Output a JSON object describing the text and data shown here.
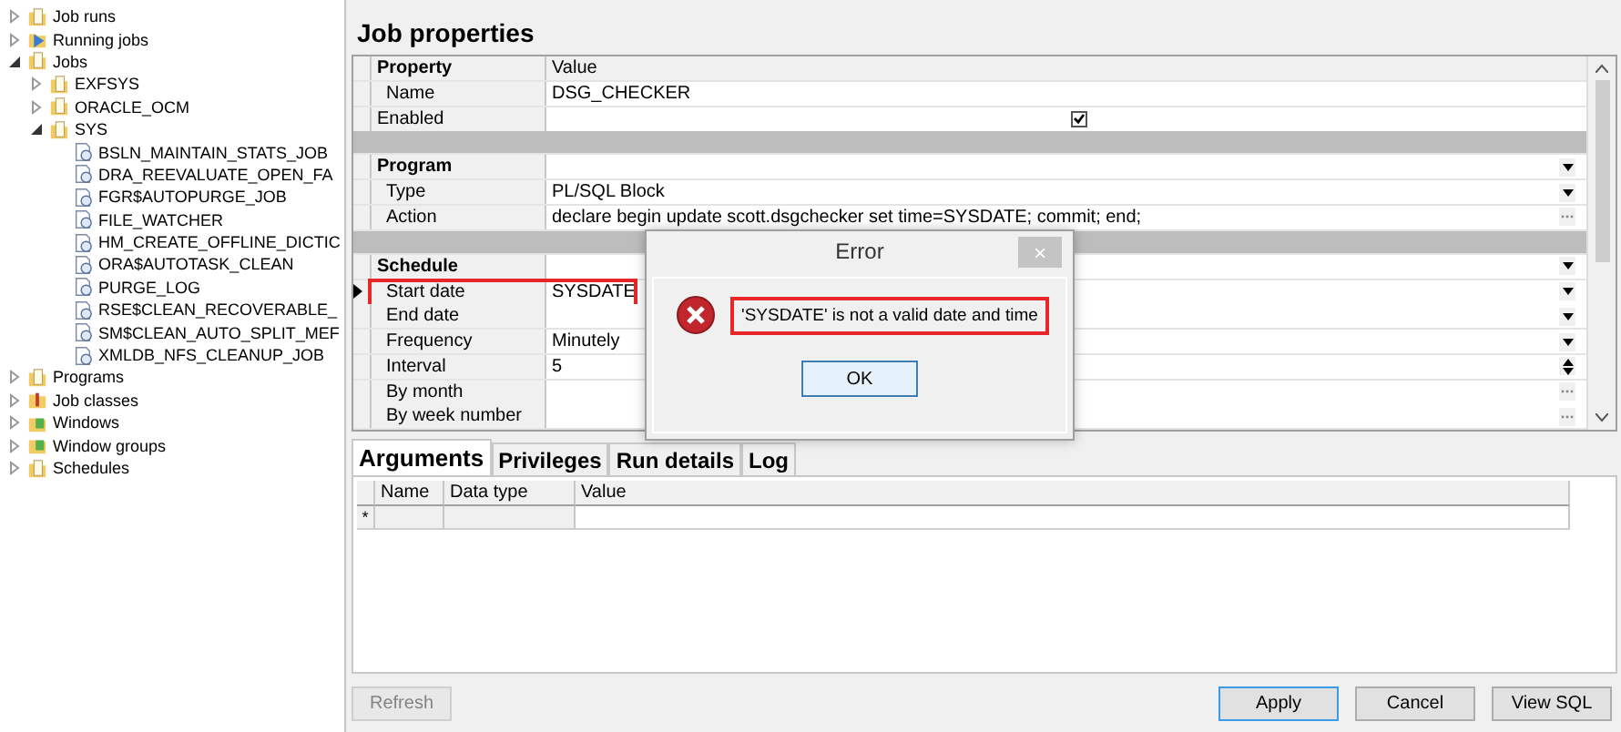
{
  "tree": [
    {
      "label": "Job runs",
      "kind": "folder",
      "expanded": false
    },
    {
      "label": "Running jobs",
      "kind": "running",
      "expanded": false
    },
    {
      "label": "Jobs",
      "kind": "folder",
      "expanded": true,
      "children": [
        {
          "label": "EXFSYS",
          "kind": "folder",
          "expanded": false
        },
        {
          "label": "ORACLE_OCM",
          "kind": "folder",
          "expanded": false
        },
        {
          "label": "SYS",
          "kind": "folder",
          "expanded": true,
          "children": [
            {
              "label": "BSLN_MAINTAIN_STATS_JOB",
              "kind": "job"
            },
            {
              "label": "DRA_REEVALUATE_OPEN_FA",
              "kind": "job"
            },
            {
              "label": "FGR$AUTOPURGE_JOB",
              "kind": "job"
            },
            {
              "label": "FILE_WATCHER",
              "kind": "job"
            },
            {
              "label": "HM_CREATE_OFFLINE_DICTIC",
              "kind": "job"
            },
            {
              "label": "ORA$AUTOTASK_CLEAN",
              "kind": "job"
            },
            {
              "label": "PURGE_LOG",
              "kind": "job"
            },
            {
              "label": "RSE$CLEAN_RECOVERABLE_",
              "kind": "job"
            },
            {
              "label": "SM$CLEAN_AUTO_SPLIT_MEF",
              "kind": "job"
            },
            {
              "label": "XMLDB_NFS_CLEANUP_JOB",
              "kind": "job"
            }
          ]
        }
      ]
    },
    {
      "label": "Programs",
      "kind": "folder",
      "expanded": false
    },
    {
      "label": "Job classes",
      "kind": "class",
      "expanded": false
    },
    {
      "label": "Windows",
      "kind": "window",
      "expanded": false
    },
    {
      "label": "Window groups",
      "kind": "window",
      "expanded": false
    },
    {
      "label": "Schedules",
      "kind": "folder",
      "expanded": false
    }
  ],
  "title": "Job properties",
  "grid": {
    "columns": [
      "Property",
      "Value"
    ],
    "rows": [
      {
        "kind": "field",
        "label": "Name",
        "value": "DSG_CHECKER"
      },
      {
        "kind": "check",
        "label": "Enabled",
        "checked": true
      },
      {
        "kind": "separator"
      },
      {
        "kind": "section",
        "label": "Program",
        "editor": {
          "kind": "dropdown"
        }
      },
      {
        "kind": "field",
        "label": "Type",
        "value": "PL/SQL Block",
        "editor": {
          "kind": "dropdown"
        }
      },
      {
        "kind": "field",
        "label": "Action",
        "value": "declare      begin         update scott.dsgchecker set time=SYSDATE;         commit;      end;",
        "editor": {
          "kind": "ellipsis"
        }
      },
      {
        "kind": "separator"
      },
      {
        "kind": "section",
        "label": "Schedule",
        "editor": {
          "kind": "dropdown"
        }
      },
      {
        "kind": "field",
        "label": "Start date",
        "value": "SYSDATE",
        "editor": {
          "kind": "dropdown"
        },
        "current": true,
        "flagged": true
      },
      {
        "kind": "field",
        "label": "End date",
        "editor": {
          "kind": "dropdown"
        }
      },
      {
        "kind": "field",
        "label": "Frequency",
        "value": "Minutely",
        "editor": {
          "kind": "dropdown"
        }
      },
      {
        "kind": "field",
        "label": "Interval",
        "value": "5",
        "editor": {
          "kind": "spin"
        }
      },
      {
        "kind": "field",
        "label": "By month",
        "editor": {
          "kind": "ellipsis"
        }
      },
      {
        "kind": "field",
        "label": "By week number",
        "editor": {
          "kind": "ellipsis"
        }
      }
    ]
  },
  "dialog": {
    "title": "Error",
    "close": "×",
    "message": "'SYSDATE' is not a valid date and time",
    "flagged": true,
    "button": "OK"
  },
  "tabs": [
    {
      "label": "Arguments",
      "selected": true
    },
    {
      "label": "Privileges",
      "selected": false
    },
    {
      "label": "Run details",
      "selected": false
    },
    {
      "label": "Log",
      "selected": false
    }
  ],
  "arguments": {
    "columns": [
      "Name",
      "Data type",
      "Value"
    ],
    "new_row_marker": "*"
  },
  "buttons": [
    {
      "label": "Refresh",
      "disabled": true
    },
    {
      "label": "Apply",
      "disabled": false,
      "default": true
    },
    {
      "label": "Cancel",
      "disabled": false
    },
    {
      "label": "View SQL",
      "disabled": false
    }
  ]
}
